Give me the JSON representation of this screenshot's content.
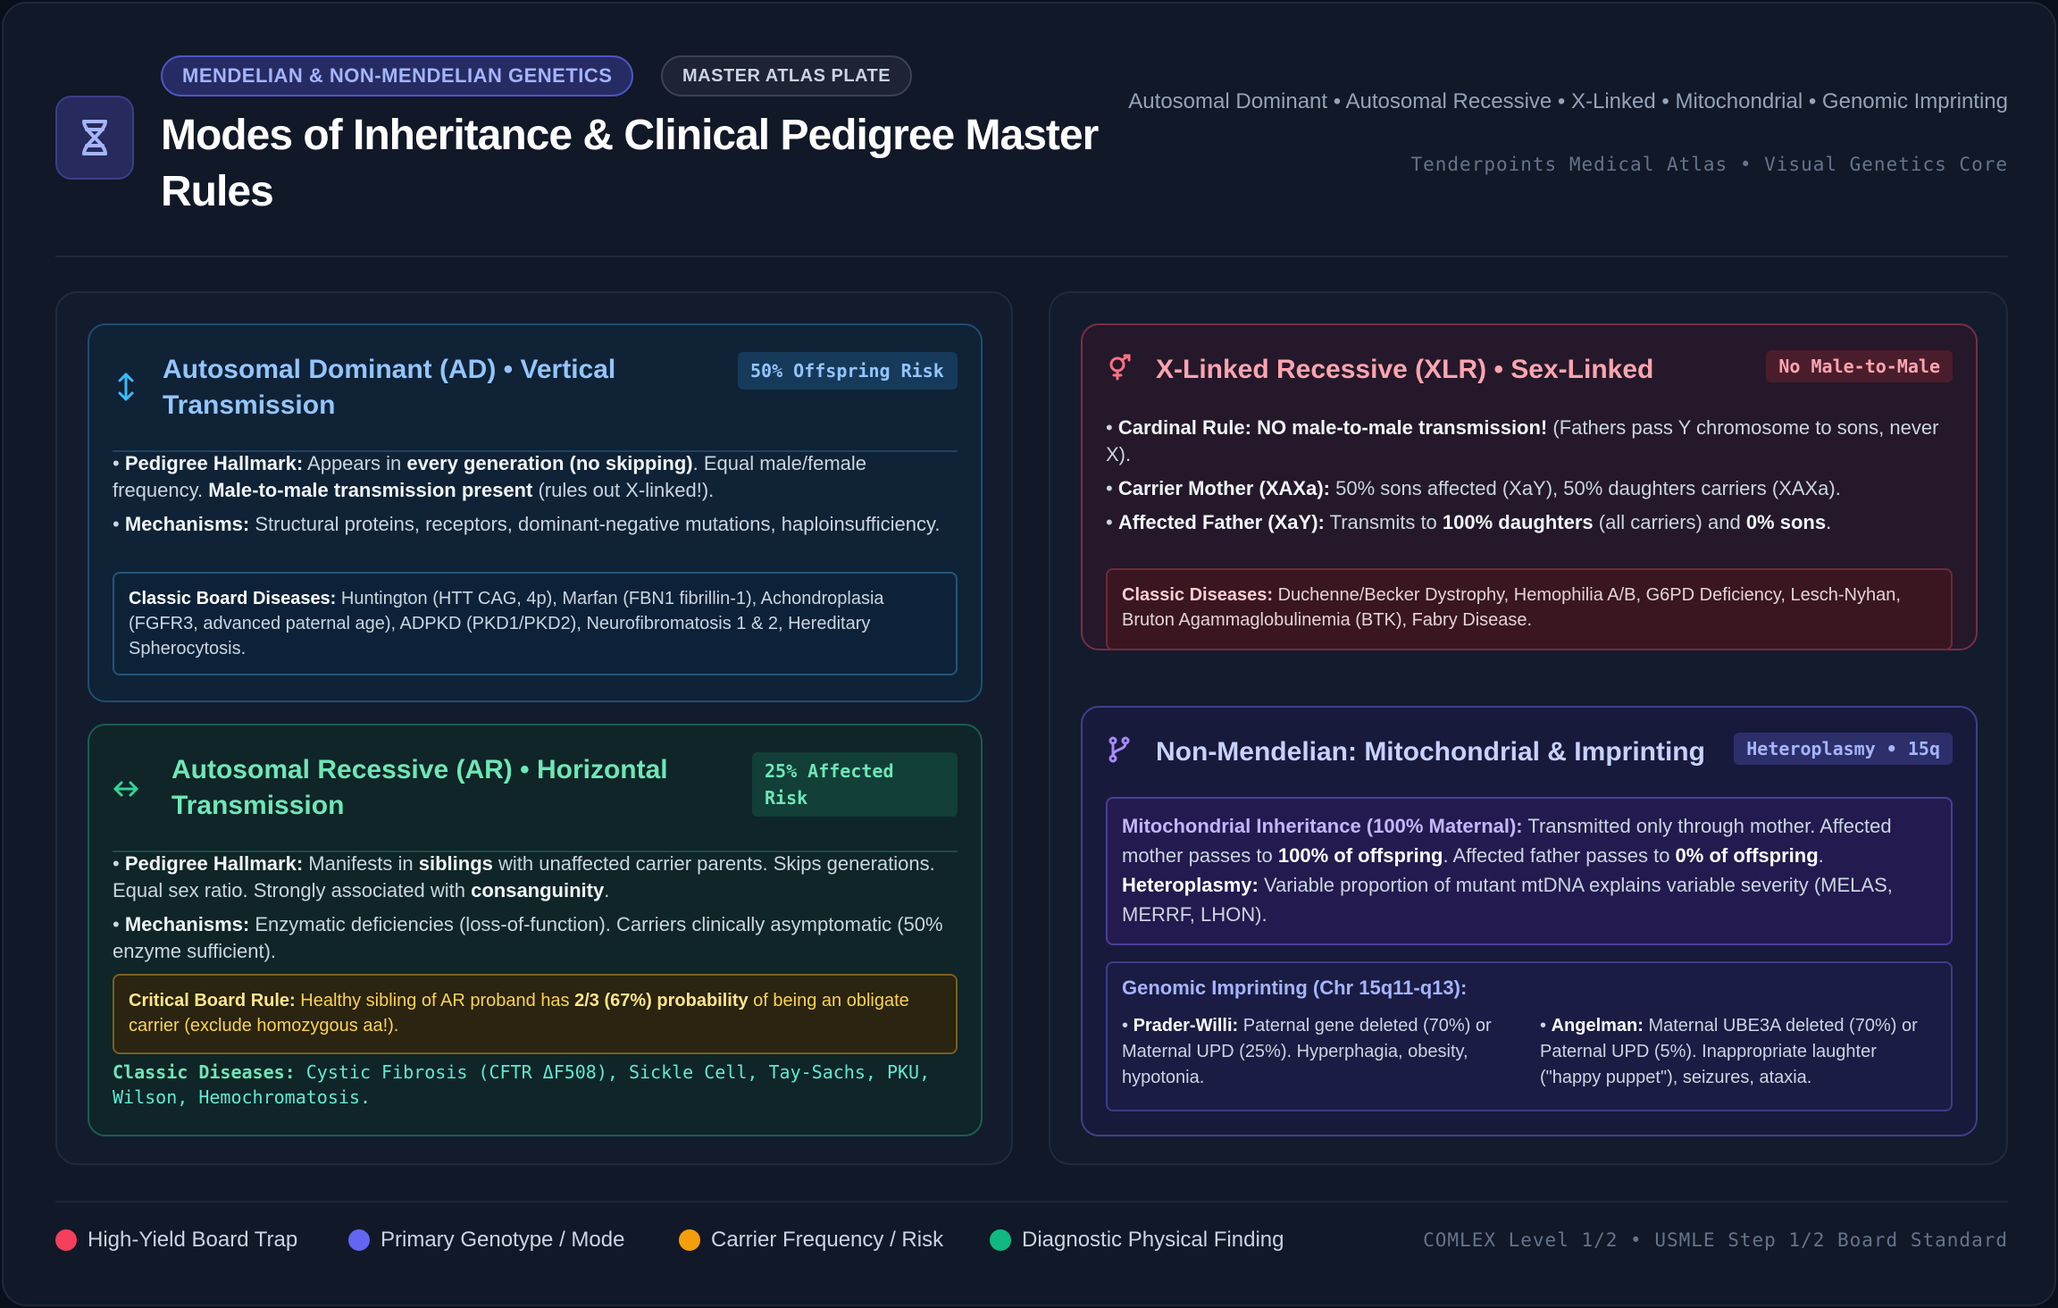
{
  "header": {
    "topic_pill": "MENDELIAN & NON-MENDELIAN GENETICS",
    "plate_pill": "MASTER ATLAS PLATE",
    "title": "Modes of Inheritance & Clinical Pedigree Master Rules",
    "subtitle": "Autosomal Dominant • Autosomal Recessive • X-Linked • Mitochondrial • Genomic Imprinting",
    "credit": "Tenderpoints Medical Atlas • Visual Genetics Core",
    "logo_icon": "dna-icon"
  },
  "ad": {
    "title": "Autosomal Dominant (AD) • Vertical Transmission",
    "badge": "50% Offspring Risk",
    "icon": "vertical-arrows-icon",
    "hallmark_label": "Pedigree Hallmark:",
    "hallmark_t1": " Appears in ",
    "hallmark_b1": "every generation (no skipping)",
    "hallmark_t2": ". Equal male/female frequency. ",
    "hallmark_b2": "Male-to-male transmission present",
    "hallmark_t3": " (rules out X-linked!).",
    "mech_label": "Mechanisms:",
    "mech_text": " Structural proteins, receptors, dominant-negative mutations, haploinsufficiency.",
    "diseases_label": "Classic Board Diseases:",
    "diseases_text": " Huntington (HTT CAG, 4p), Marfan (FBN1 fibrillin-1), Achondroplasia (FGFR3, advanced paternal age), ADPKD (PKD1/PKD2), Neurofibromatosis 1 & 2, Hereditary Spherocytosis."
  },
  "ar": {
    "title": "Autosomal Recessive (AR) • Horizontal Transmission",
    "badge": "25% Affected Risk",
    "icon": "horizontal-arrows-icon",
    "hallmark_label": "Pedigree Hallmark:",
    "hallmark_t1": " Manifests in ",
    "hallmark_b1": "siblings",
    "hallmark_t2": " with unaffected carrier parents. Skips generations. Equal sex ratio. Strongly associated with ",
    "hallmark_b2": "consanguinity",
    "hallmark_t3": ".",
    "mech_label": "Mechanisms:",
    "mech_text": " Enzymatic deficiencies (loss-of-function). Carriers clinically asymptomatic (50% enzyme sufficient).",
    "critical_label": "Critical Board Rule:",
    "critical_t1": " Healthy sibling of AR proband has ",
    "critical_b1": "2/3 (67%) probability",
    "critical_t2": " of being an obligate carrier (exclude homozygous aa!).",
    "classic_label": "Classic Diseases:",
    "classic_text": " Cystic Fibrosis (CFTR ΔF508), Sickle Cell, Tay-Sachs, PKU, Wilson, Hemochromatosis."
  },
  "xlr": {
    "title": "X-Linked Recessive (XLR) • Sex-Linked",
    "badge": "No Male-to-Male",
    "icon": "gender-symbol-icon",
    "cardinal_label": "Cardinal Rule: NO male-to-male transmission!",
    "cardinal_text": " (Fathers pass Y chromosome to sons, never X).",
    "mother_label": "Carrier Mother (XAXa):",
    "mother_text": " 50% sons affected (XaY), 50% daughters carriers (XAXa).",
    "father_label": "Affected Father (XaY):",
    "father_t1": " Transmits to ",
    "father_b1": "100% daughters",
    "father_t2": " (all carriers) and ",
    "father_b2": "0% sons",
    "father_t3": ".",
    "diseases_label": "Classic Diseases:",
    "diseases_text": " Duchenne/Becker Dystrophy, Hemophilia A/B, G6PD Deficiency, Lesch-Nyhan, Bruton Agammaglobulinemia (BTK), Fabry Disease."
  },
  "nm": {
    "title": "Non-Mendelian: Mitochondrial & Imprinting",
    "badge": "Heteroplasmy • 15q",
    "icon": "branch-icon",
    "mito_label": "Mitochondrial Inheritance (100% Maternal):",
    "mito_t1": " Transmitted only through mother. Affected mother passes to ",
    "mito_b1": "100% of offspring",
    "mito_t2": ". Affected father passes to ",
    "mito_b2": "0% of offspring",
    "mito_t3": ". ",
    "mito_b3": "Heteroplasmy:",
    "mito_t4": " Variable proportion of mutant mtDNA explains variable severity (MELAS, MERRF, LHON).",
    "imprint_title": "Genomic Imprinting (Chr 15q11-q13):",
    "pw_label": "Prader-Willi:",
    "pw_text": " Paternal gene deleted (70%) or Maternal UPD (25%). Hyperphagia, obesity, hypotonia.",
    "as_label": "Angelman:",
    "as_text": " Maternal UBE3A deleted (70%) or Paternal UPD (5%). Inappropriate laughter (\"happy puppet\"), seizures, ataxia."
  },
  "footer": {
    "legend": [
      {
        "label": "High-Yield Board Trap",
        "color": "#f43f5e"
      },
      {
        "label": "Primary Genotype / Mode",
        "color": "#6366f1"
      },
      {
        "label": "Carrier Frequency / Risk",
        "color": "#f59e0b"
      },
      {
        "label": "Diagnostic Physical Finding",
        "color": "#10b981"
      }
    ],
    "standard": "COMLEX Level 1/2 • USMLE Step 1/2 Board Standard"
  },
  "colors": {
    "background": "#111827",
    "ad_accent": "#93c5fd",
    "ar_accent": "#6ee7b7",
    "xlr_accent": "#fda4af",
    "nm_accent": "#c7d2fe",
    "critical_accent": "#fcd34d"
  }
}
